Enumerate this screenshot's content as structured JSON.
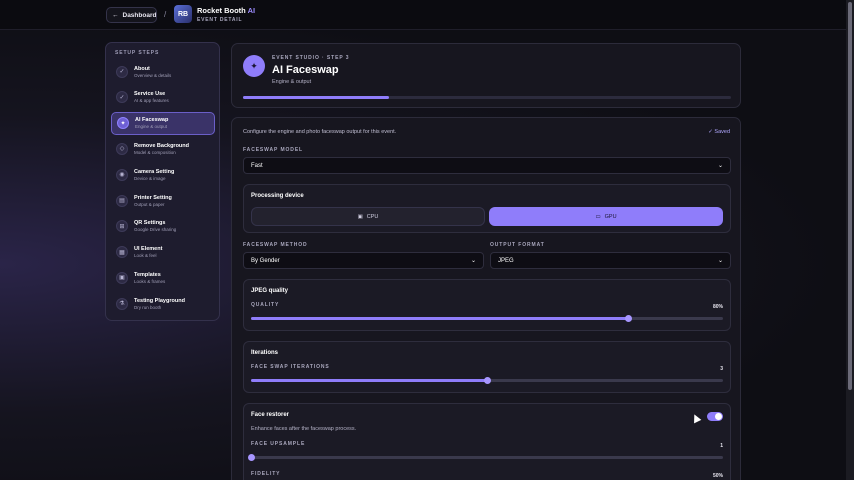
{
  "topbar": {
    "back_label": "Dashboard",
    "separator": "/",
    "logo_text": "RB",
    "brand_name": "Rocket Booth",
    "brand_ai": "AI",
    "brand_sub": "EVENT DETAIL"
  },
  "sidebar": {
    "title": "SETUP STEPS",
    "items": [
      {
        "label": "About",
        "desc": "Overview & details",
        "icon": "check-icon",
        "glyph": "✓",
        "active": false
      },
      {
        "label": "Service Use",
        "desc": "AI & app features",
        "icon": "check-icon",
        "glyph": "✓",
        "active": false
      },
      {
        "label": "AI Faceswap",
        "desc": "Engine & output",
        "icon": "wand-icon",
        "glyph": "✦",
        "active": true
      },
      {
        "label": "Remove Background",
        "desc": "Model & composition",
        "icon": "eraser-icon",
        "glyph": "◇",
        "active": false
      },
      {
        "label": "Camera Setting",
        "desc": "Device & image",
        "icon": "camera-icon",
        "glyph": "◉",
        "active": false
      },
      {
        "label": "Printer Setting",
        "desc": "Output & paper",
        "icon": "printer-icon",
        "glyph": "▤",
        "active": false
      },
      {
        "label": "QR Settings",
        "desc": "Google Drive sharing",
        "icon": "qr-icon",
        "glyph": "⊞",
        "active": false
      },
      {
        "label": "UI Element",
        "desc": "Look & feel",
        "icon": "layers-icon",
        "glyph": "▦",
        "active": false
      },
      {
        "label": "Templates",
        "desc": "Looks & frames",
        "icon": "template-icon",
        "glyph": "▣",
        "active": false
      },
      {
        "label": "Testing Playground",
        "desc": "Dry run booth",
        "icon": "flask-icon",
        "glyph": "⚗",
        "active": false
      }
    ]
  },
  "header": {
    "kicker": "EVENT STUDIO · STEP 3",
    "title": "AI Faceswap",
    "subtitle": "Engine & output",
    "progress": 0.3
  },
  "main": {
    "intro": "Configure the engine and photo faceswap output for this event.",
    "saved": "✓ Saved",
    "model_label": "FACESWAP MODEL",
    "model_value": "Fast",
    "device": {
      "title": "Processing device",
      "cpu_label": "CPU",
      "gpu_label": "GPU",
      "selected": "GPU"
    },
    "method_label": "FACESWAP METHOD",
    "method_value": "By Gender",
    "format_label": "OUTPUT FORMAT",
    "format_value": "JPEG",
    "jpeg": {
      "title": "JPEG quality",
      "slider_label": "QUALITY",
      "value_text": "80%",
      "value": 0.8
    },
    "iterations": {
      "title": "Iterations",
      "slider_label": "FACE SWAP ITERATIONS",
      "value_text": "3",
      "value": 0.5
    },
    "restorer": {
      "title": "Face restorer",
      "enabled": true,
      "desc": "Enhance faces after the faceswap process.",
      "upsample_label": "FACE UPSAMPLE",
      "upsample_text": "1",
      "upsample_value": 0.0,
      "fidelity_label": "FIDELITY",
      "fidelity_text": "50%"
    }
  },
  "colors": {
    "accent": "#8f7dfa",
    "bg": "#0e0e14",
    "card": "#17161f"
  }
}
